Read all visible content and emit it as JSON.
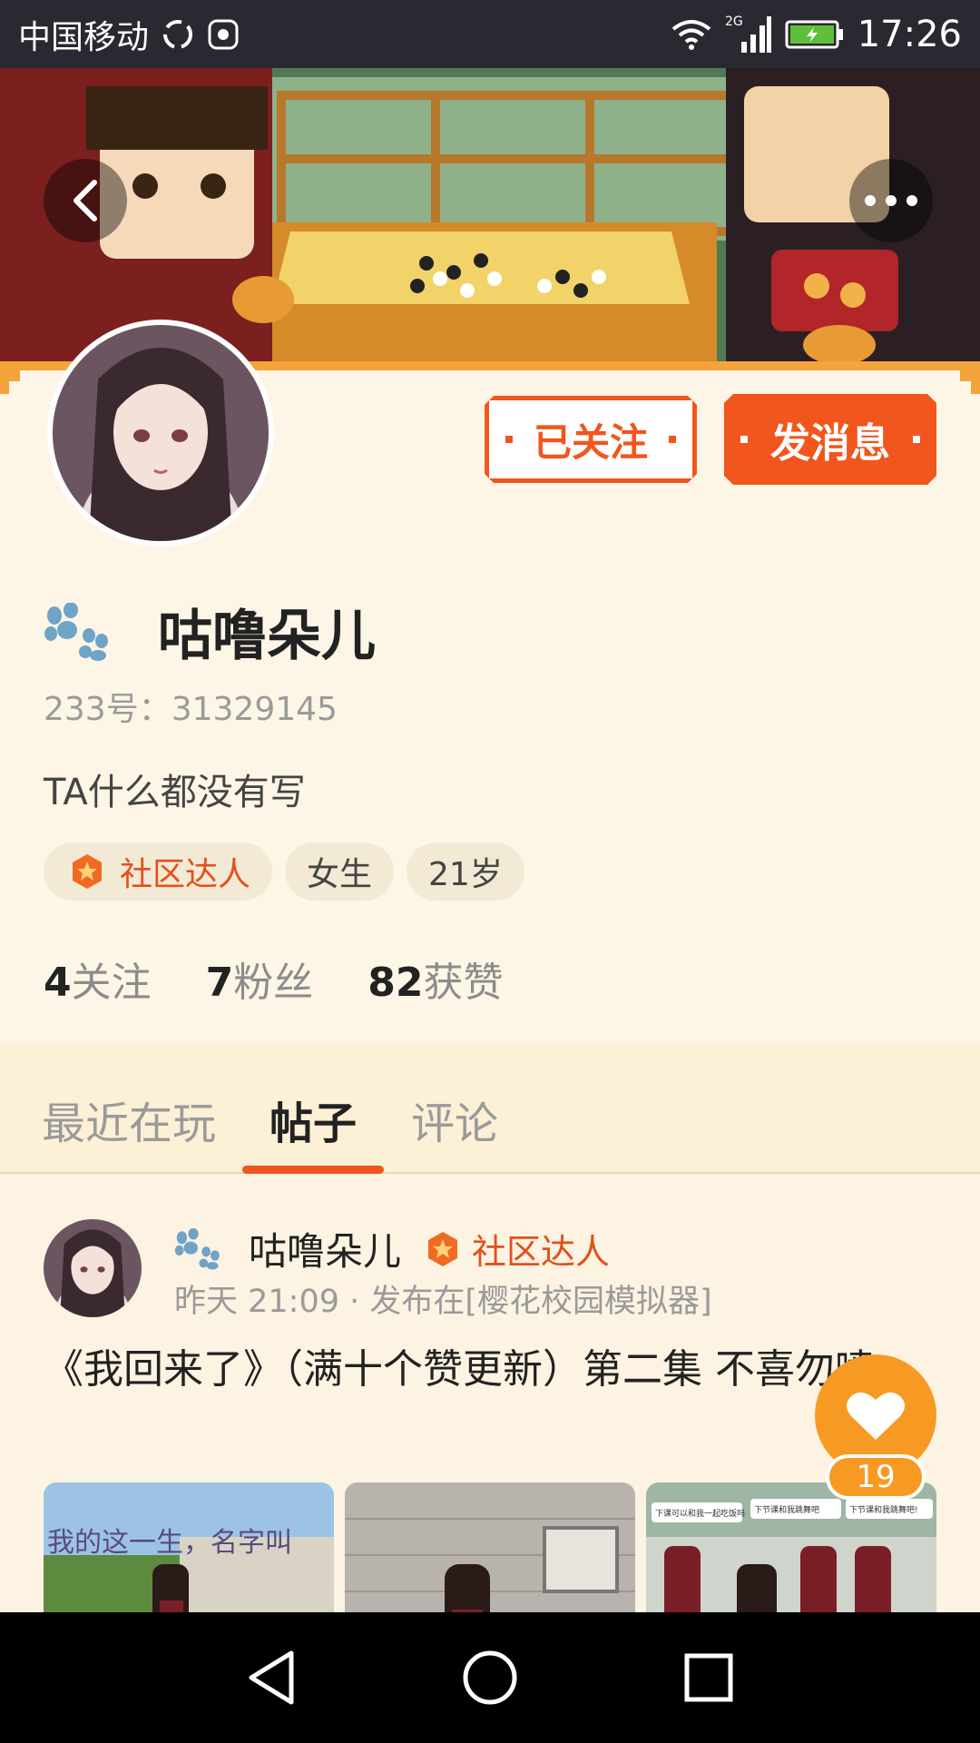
{
  "status_bar": {
    "carrier": "中国移动",
    "network": "2G",
    "time": "17:26"
  },
  "banner": {
    "back_icon": "chevron-left-icon",
    "more_icon": "more-dots-icon"
  },
  "profile": {
    "follow_button": "已关注",
    "message_button": "发消息",
    "name": "咕噜朵儿",
    "uid": "233号：31329145",
    "bio": "TA什么都没有写",
    "tags": {
      "expert": "社区达人",
      "gender": "女生",
      "age": "21岁"
    },
    "stats": {
      "following_count": "4",
      "following_label": "关注",
      "fans_count": "7",
      "fans_label": "粉丝",
      "likes_count": "82",
      "likes_label": "获赞"
    }
  },
  "tabs": {
    "recent": "最近在玩",
    "posts": "帖子",
    "comments": "评论",
    "active": "posts"
  },
  "post": {
    "author": "咕噜朵儿",
    "badge": "社区达人",
    "meta": "昨天 21:09 · 发布在[樱花校园模拟器]",
    "title": "《我回来了》（满十个赞更新）第二集  不喜勿喷",
    "thumb_texts": {
      "t1_overlay": "我的这一生，名字叫",
      "t3_bubble1": "下课可以和我一起吃饭吗",
      "t3_bubble2": "下节课和我跳舞吧",
      "t3_bubble3": "下节课和我跳舞吧!"
    }
  },
  "like": {
    "count": "19"
  },
  "colors": {
    "accent": "#f0561d",
    "like": "#f79a23",
    "background": "#fdf6e6"
  }
}
